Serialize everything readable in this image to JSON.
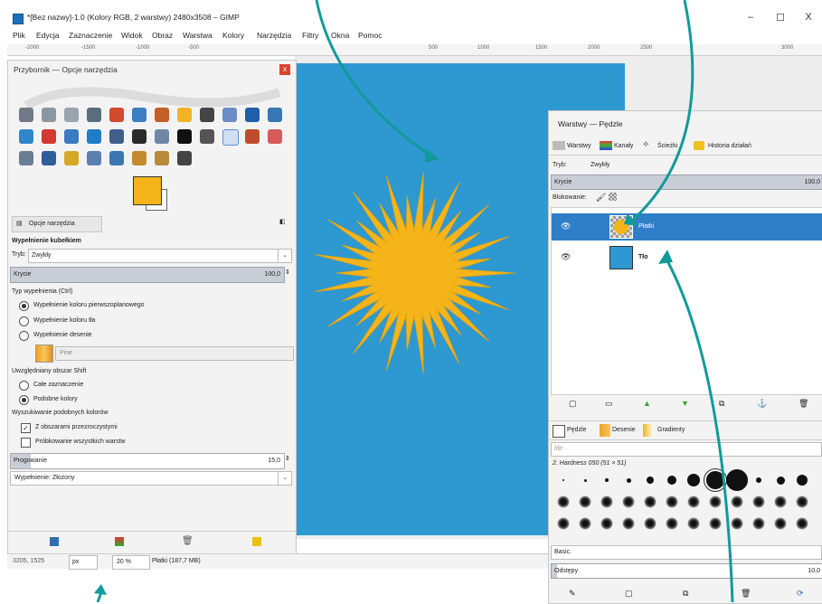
{
  "window": {
    "title": "*[Bez nazwy]-1.0 (Kolory RGB, 2 warstwy) 2480x3508 – GIMP",
    "minimize": "–",
    "maximize": "☐",
    "close": "X"
  },
  "menu": [
    "Plik",
    "Edycja",
    "Zaznaczenie",
    "Widok",
    "Obraz",
    "Warstwa",
    "Kolory",
    "Narzędzia",
    "Filtry",
    "Okna",
    "Pomoc"
  ],
  "ruler": {
    "ticks": [
      "-2000",
      "-1500",
      "-1000",
      "-500",
      "500",
      "1000",
      "1500",
      "2000",
      "2500",
      "3000"
    ]
  },
  "toolbox": {
    "title": "Przybornik — Opcje narzędzia",
    "close": "x",
    "tab_label": "Opcje narzędzia",
    "tool_name": "Wypełnienie kubełkiem",
    "mode_label": "Tryb:",
    "mode_value": "Zwykły",
    "opacity_label": "Krycie",
    "opacity_value": "100,0",
    "fill_type_label": "Typ wypełnienia  (Ctrl)",
    "fill_options": [
      "Wypełnienie koloru pierwszoplanowego",
      "Wypełnienie koloru tła",
      "Wypełnienie desenie"
    ],
    "pattern_name": "Pine",
    "area_label": "Uwzględniany obszar  Shift",
    "area_options": [
      "Całe zaznaczenie",
      "Podobne kolory"
    ],
    "find_label": "Wyszukiwanie podobnych kolorów",
    "transparent_label": "Z obszarami przezroczystymi",
    "sample_merged_label": "Próbkowanie wszystkich warstw",
    "threshold_label": "Progowanie",
    "threshold_value": "15,0",
    "fill_by_label": "Wypełnienie: Złożony",
    "colors": {
      "fg": "#f5b41a",
      "bg": "#ffffff"
    }
  },
  "status": {
    "coords": "3205, 1525",
    "unit": "px",
    "zoom": "20 %",
    "info": "Płatki (187,7 MB)"
  },
  "layers_panel": {
    "title": "Warstwy — Pędzle",
    "tabs": [
      "Warstwy",
      "Kanały",
      "Ścieżki",
      "Historia działań"
    ],
    "mode_label": "Tryb:",
    "mode_value": "Zwykły",
    "opacity_label": "Krycie",
    "opacity_value": "100,0",
    "lock_label": "Blokowanie:",
    "layers": [
      {
        "name": "Płatki",
        "selected": true
      },
      {
        "name": "Tło",
        "selected": false
      }
    ],
    "brush_tabs": [
      "Pędzle",
      "Desenie",
      "Gradienty"
    ],
    "filter_placeholder": "filtr",
    "brush_name": "2. Hardness 050 (51 × 51)",
    "preset": "Basic.",
    "spacing_label": "Odstępy",
    "spacing_value": "10,0"
  },
  "image": {
    "canvas_color": "#2e98d0",
    "flower_color": "#f5b41a"
  },
  "accent_color": "#129a9a"
}
